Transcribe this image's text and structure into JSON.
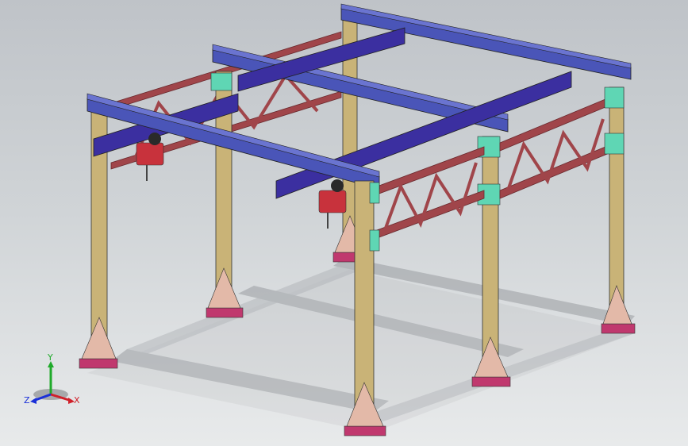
{
  "viewport": {
    "background_top": "#bfc3c8",
    "background_bottom": "#e8eaeb"
  },
  "colors": {
    "column": "#c9b377",
    "column_dark": "#9c8a55",
    "baseplate": "#c0386e",
    "gusset": "#e3b9a8",
    "runway_beam": "#4a55b8",
    "runway_beam_light": "#6a74d0",
    "bridge_girder": "#3b2fa0",
    "truss": "#a0454a",
    "connection_plate": "#5fd6b4",
    "hoist": "#c8323c",
    "shadow": "#9a9da1"
  },
  "triad": {
    "x_label": "X",
    "y_label": "Y",
    "z_label": "Z",
    "x_color": "#d0202a",
    "y_color": "#1faa2a",
    "z_color": "#1a2fd8"
  }
}
